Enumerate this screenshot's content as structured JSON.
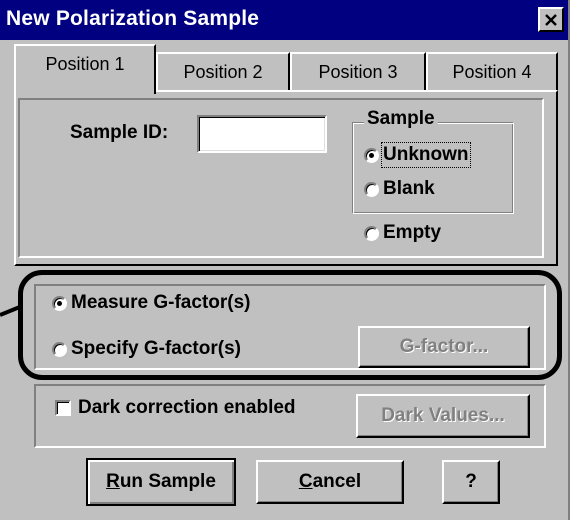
{
  "window": {
    "title": "New Polarization Sample",
    "close_glyph": "×"
  },
  "tabs": [
    {
      "label": "Position 1",
      "active": true
    },
    {
      "label": "Position 2",
      "active": false
    },
    {
      "label": "Position 3",
      "active": false
    },
    {
      "label": "Position 4",
      "active": false
    }
  ],
  "sample_id": {
    "label": "Sample ID:",
    "value": ""
  },
  "sample_group": {
    "label": "Sample",
    "options": [
      {
        "label": "Unknown",
        "checked": true
      },
      {
        "label": "Blank",
        "checked": false
      },
      {
        "label": "Empty",
        "checked": false
      }
    ]
  },
  "gfactor": {
    "measure_label": "Measure G-factor(s)",
    "specify_label": "Specify G-factor(s)",
    "button_label": "G-factor...",
    "measure_checked": true
  },
  "dark": {
    "checkbox_label": "Dark correction enabled",
    "checked": false,
    "button_label": "Dark Values..."
  },
  "buttons": {
    "run_prefix": "R",
    "run_rest": "un Sample",
    "cancel_prefix": "C",
    "cancel_rest": "ancel",
    "help": "?"
  }
}
